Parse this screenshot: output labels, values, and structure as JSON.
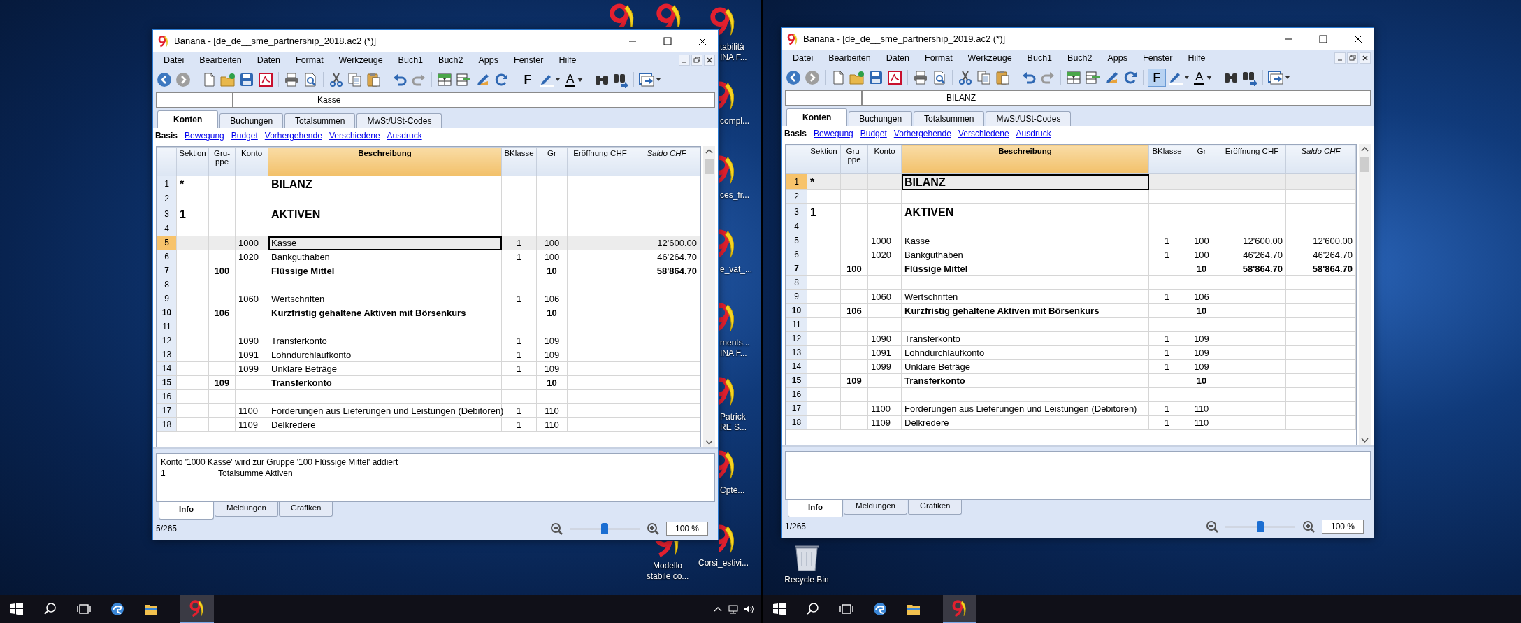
{
  "screens": [
    {
      "window": {
        "title": "Banana - [de_de__sme_partnership_2018.ac2 (*)]",
        "menu": [
          "Datei",
          "Bearbeiten",
          "Daten",
          "Format",
          "Werkzeuge",
          "Buch1",
          "Buch2",
          "Apps",
          "Fenster",
          "Hilfe"
        ],
        "toolbar": {
          "bold_label": "F",
          "bold_pressed": false,
          "color_label": "A"
        },
        "content_field": {
          "value": "Kasse"
        },
        "tabs": [
          {
            "label": "Konten",
            "selected": true
          },
          {
            "label": "Buchungen",
            "selected": false
          },
          {
            "label": "Totalsummen",
            "selected": false
          },
          {
            "label": "MwSt/USt-Codes",
            "selected": false
          }
        ],
        "views": [
          {
            "label": "Basis",
            "selected": true
          },
          {
            "label": "Bewegung",
            "selected": false
          },
          {
            "label": "Budget",
            "selected": false
          },
          {
            "label": "Vorhergehende",
            "selected": false
          },
          {
            "label": "Verschiedene",
            "selected": false
          },
          {
            "label": "Ausdruck",
            "selected": false
          }
        ],
        "columns": [
          {
            "label": "Sektion",
            "selected": false,
            "italic": false
          },
          {
            "label": "Gru-ppe",
            "selected": false,
            "italic": false
          },
          {
            "label": "Konto",
            "selected": false,
            "italic": false
          },
          {
            "label": "Beschreibung",
            "selected": true,
            "italic": false
          },
          {
            "label": "BKlasse",
            "selected": false,
            "italic": false
          },
          {
            "label": "Gr",
            "selected": false,
            "italic": false
          },
          {
            "label": "Eröffnung CHF",
            "selected": false,
            "italic": false
          },
          {
            "label": "Saldo CHF",
            "selected": false,
            "italic": true
          }
        ],
        "rows": [
          {
            "no": "1",
            "kind": "title",
            "selected": false,
            "sektion": "*",
            "beschreibung": "BILANZ"
          },
          {
            "no": "2",
            "kind": "blank",
            "selected": false
          },
          {
            "no": "3",
            "kind": "title",
            "selected": false,
            "sektion": "1",
            "beschreibung": "AKTIVEN"
          },
          {
            "no": "4",
            "kind": "blank",
            "selected": false
          },
          {
            "no": "5",
            "kind": "account",
            "selected": true,
            "konto": "1000",
            "beschreibung": "Kasse",
            "bklasse": "1",
            "gr": "100",
            "saldo": "12'600.00"
          },
          {
            "no": "6",
            "kind": "account",
            "selected": false,
            "konto": "1020",
            "beschreibung": "Bankguthaben",
            "bklasse": "1",
            "gr": "100",
            "saldo": "46'264.70"
          },
          {
            "no": "7",
            "kind": "total",
            "selected": false,
            "gruppe": "100",
            "beschreibung": "Flüssige Mittel",
            "gr": "10",
            "saldo": "58'864.70"
          },
          {
            "no": "8",
            "kind": "blank",
            "selected": false
          },
          {
            "no": "9",
            "kind": "account",
            "selected": false,
            "konto": "1060",
            "beschreibung": "Wertschriften",
            "bklasse": "1",
            "gr": "106"
          },
          {
            "no": "10",
            "kind": "total",
            "selected": false,
            "gruppe": "106",
            "beschreibung": "Kurzfristig gehaltene Aktiven mit Börsenkurs",
            "gr": "10"
          },
          {
            "no": "11",
            "kind": "blank",
            "selected": false
          },
          {
            "no": "12",
            "kind": "account",
            "selected": false,
            "konto": "1090",
            "beschreibung": "Transferkonto",
            "bklasse": "1",
            "gr": "109"
          },
          {
            "no": "13",
            "kind": "account",
            "selected": false,
            "konto": "1091",
            "beschreibung": "Lohndurchlaufkonto",
            "bklasse": "1",
            "gr": "109"
          },
          {
            "no": "14",
            "kind": "account",
            "selected": false,
            "konto": "1099",
            "beschreibung": "Unklare Beträge",
            "bklasse": "1",
            "gr": "109"
          },
          {
            "no": "15",
            "kind": "total",
            "selected": false,
            "gruppe": "109",
            "beschreibung": "Transferkonto",
            "gr": "10"
          },
          {
            "no": "16",
            "kind": "blank",
            "selected": false
          },
          {
            "no": "17",
            "kind": "account",
            "selected": false,
            "konto": "1100",
            "beschreibung": "Forderungen aus Lieferungen und Leistungen (Debitoren)",
            "bklasse": "1",
            "gr": "110"
          },
          {
            "no": "18",
            "kind": "account",
            "selected": false,
            "konto": "1109",
            "beschreibung": "Delkredere",
            "bklasse": "1",
            "gr": "110"
          }
        ],
        "info_lines": [
          {
            "kind": "message",
            "text": "Konto '1000 Kasse' wird zur Gruppe '100 Flüssige Mittel' addiert"
          },
          {
            "kind": "entry",
            "code": "1",
            "text": "Totalsumme Aktiven"
          }
        ],
        "bottom_tabs": [
          {
            "label": "Info",
            "selected": true
          },
          {
            "label": "Meldungen",
            "selected": false
          },
          {
            "label": "Grafiken",
            "selected": false
          }
        ],
        "status": {
          "position": "5/265",
          "zoom": {
            "level": 0.5,
            "value": "100 %"
          }
        }
      },
      "desktop_icons": [
        {
          "kind": "banana"
        },
        {
          "kind": "banana"
        },
        {
          "kind": "banana",
          "label": [
            "tabilità",
            "INA F..."
          ]
        },
        {
          "kind": "banana",
          "label": [
            "compl..."
          ]
        },
        {
          "kind": "banana",
          "label": [
            "ces_fr..."
          ]
        },
        {
          "kind": "banana",
          "label": [
            "e_vat_..."
          ]
        },
        {
          "kind": "banana",
          "label": [
            "ments...",
            "INA F..."
          ]
        },
        {
          "kind": "banana",
          "label": [
            "Patrick",
            "RE S..."
          ]
        },
        {
          "kind": "banana",
          "label": [
            "Cpté..."
          ]
        },
        {
          "kind": "banana",
          "label": [
            "Modello",
            "stabile co..."
          ]
        },
        {
          "kind": "banana",
          "label": [
            "Corsi_estivi..."
          ]
        }
      ]
    },
    {
      "window": {
        "title": "Banana - [de_de__sme_partnership_2019.ac2 (*)]",
        "menu": [
          "Datei",
          "Bearbeiten",
          "Daten",
          "Format",
          "Werkzeuge",
          "Buch1",
          "Buch2",
          "Apps",
          "Fenster",
          "Hilfe"
        ],
        "toolbar": {
          "bold_label": "F",
          "bold_pressed": true,
          "color_label": "A"
        },
        "content_field": {
          "value": "BILANZ"
        },
        "tabs": [
          {
            "label": "Konten",
            "selected": true
          },
          {
            "label": "Buchungen",
            "selected": false
          },
          {
            "label": "Totalsummen",
            "selected": false
          },
          {
            "label": "MwSt/USt-Codes",
            "selected": false
          }
        ],
        "views": [
          {
            "label": "Basis",
            "selected": true
          },
          {
            "label": "Bewegung",
            "selected": false
          },
          {
            "label": "Budget",
            "selected": false
          },
          {
            "label": "Vorhergehende",
            "selected": false
          },
          {
            "label": "Verschiedene",
            "selected": false
          },
          {
            "label": "Ausdruck",
            "selected": false
          }
        ],
        "columns": [
          {
            "label": "Sektion",
            "selected": false,
            "italic": false
          },
          {
            "label": "Gru-ppe",
            "selected": false,
            "italic": false
          },
          {
            "label": "Konto",
            "selected": false,
            "italic": false
          },
          {
            "label": "Beschreibung",
            "selected": true,
            "italic": false
          },
          {
            "label": "BKlasse",
            "selected": false,
            "italic": false
          },
          {
            "label": "Gr",
            "selected": false,
            "italic": false
          },
          {
            "label": "Eröffnung CHF",
            "selected": false,
            "italic": false
          },
          {
            "label": "Saldo CHF",
            "selected": false,
            "italic": true
          }
        ],
        "rows": [
          {
            "no": "1",
            "kind": "title",
            "selected": true,
            "sektion": "*",
            "beschreibung": "BILANZ"
          },
          {
            "no": "2",
            "kind": "blank",
            "selected": false
          },
          {
            "no": "3",
            "kind": "title",
            "selected": false,
            "sektion": "1",
            "beschreibung": "AKTIVEN"
          },
          {
            "no": "4",
            "kind": "blank",
            "selected": false
          },
          {
            "no": "5",
            "kind": "account",
            "selected": false,
            "konto": "1000",
            "beschreibung": "Kasse",
            "bklasse": "1",
            "gr": "100",
            "eroeffnung": "12'600.00",
            "saldo": "12'600.00"
          },
          {
            "no": "6",
            "kind": "account",
            "selected": false,
            "konto": "1020",
            "beschreibung": "Bankguthaben",
            "bklasse": "1",
            "gr": "100",
            "eroeffnung": "46'264.70",
            "saldo": "46'264.70"
          },
          {
            "no": "7",
            "kind": "total",
            "selected": false,
            "gruppe": "100",
            "beschreibung": "Flüssige Mittel",
            "gr": "10",
            "eroeffnung": "58'864.70",
            "saldo": "58'864.70"
          },
          {
            "no": "8",
            "kind": "blank",
            "selected": false
          },
          {
            "no": "9",
            "kind": "account",
            "selected": false,
            "konto": "1060",
            "beschreibung": "Wertschriften",
            "bklasse": "1",
            "gr": "106"
          },
          {
            "no": "10",
            "kind": "total",
            "selected": false,
            "gruppe": "106",
            "beschreibung": "Kurzfristig gehaltene Aktiven mit Börsenkurs",
            "gr": "10"
          },
          {
            "no": "11",
            "kind": "blank",
            "selected": false
          },
          {
            "no": "12",
            "kind": "account",
            "selected": false,
            "konto": "1090",
            "beschreibung": "Transferkonto",
            "bklasse": "1",
            "gr": "109"
          },
          {
            "no": "13",
            "kind": "account",
            "selected": false,
            "konto": "1091",
            "beschreibung": "Lohndurchlaufkonto",
            "bklasse": "1",
            "gr": "109"
          },
          {
            "no": "14",
            "kind": "account",
            "selected": false,
            "konto": "1099",
            "beschreibung": "Unklare Beträge",
            "bklasse": "1",
            "gr": "109"
          },
          {
            "no": "15",
            "kind": "total",
            "selected": false,
            "gruppe": "109",
            "beschreibung": "Transferkonto",
            "gr": "10"
          },
          {
            "no": "16",
            "kind": "blank",
            "selected": false
          },
          {
            "no": "17",
            "kind": "account",
            "selected": false,
            "konto": "1100",
            "beschreibung": "Forderungen aus Lieferungen und Leistungen (Debitoren)",
            "bklasse": "1",
            "gr": "110"
          },
          {
            "no": "18",
            "kind": "account",
            "selected": false,
            "konto": "1109",
            "beschreibung": "Delkredere",
            "bklasse": "1",
            "gr": "110"
          }
        ],
        "bottom_tabs": [
          {
            "label": "Info",
            "selected": true
          },
          {
            "label": "Meldungen",
            "selected": false
          },
          {
            "label": "Grafiken",
            "selected": false
          }
        ],
        "status": {
          "position": "1/265",
          "zoom": {
            "level": 0.5,
            "value": "100 %"
          }
        }
      },
      "desktop_icons": [
        {
          "kind": "recycle_bin",
          "label": [
            "Recycle Bin"
          ]
        }
      ]
    }
  ]
}
